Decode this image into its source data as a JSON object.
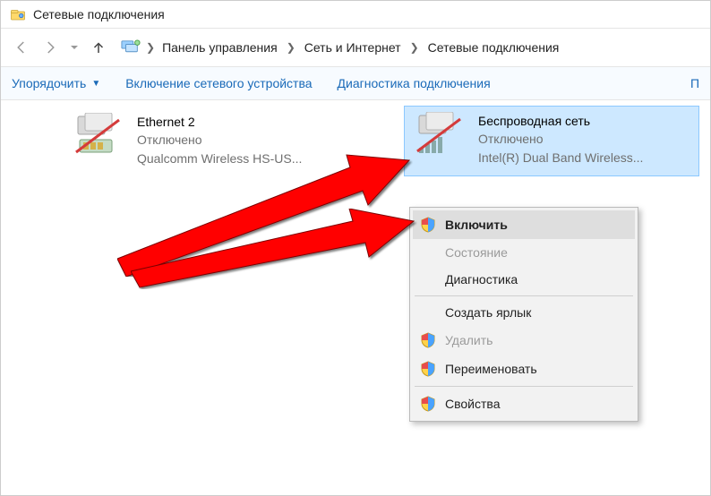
{
  "window": {
    "title": "Сетевые подключения"
  },
  "breadcrumb": {
    "items": [
      "Панель управления",
      "Сеть и Интернет",
      "Сетевые подключения"
    ]
  },
  "toolbar": {
    "organize": "Упорядочить",
    "enable_device": "Включение сетевого устройства",
    "diagnose": "Диагностика подключения",
    "more": "П"
  },
  "adapters": [
    {
      "name": "Ethernet 2",
      "status": "Отключено",
      "desc": "Qualcomm Wireless HS-US..."
    },
    {
      "name": "Беспроводная сеть",
      "status": "Отключено",
      "desc": "Intel(R) Dual Band Wireless..."
    }
  ],
  "context_menu": {
    "enable": "Включить",
    "status": "Состояние",
    "diagnostics": "Диагностика",
    "create_shortcut": "Создать ярлык",
    "delete": "Удалить",
    "rename": "Переименовать",
    "properties": "Свойства"
  }
}
